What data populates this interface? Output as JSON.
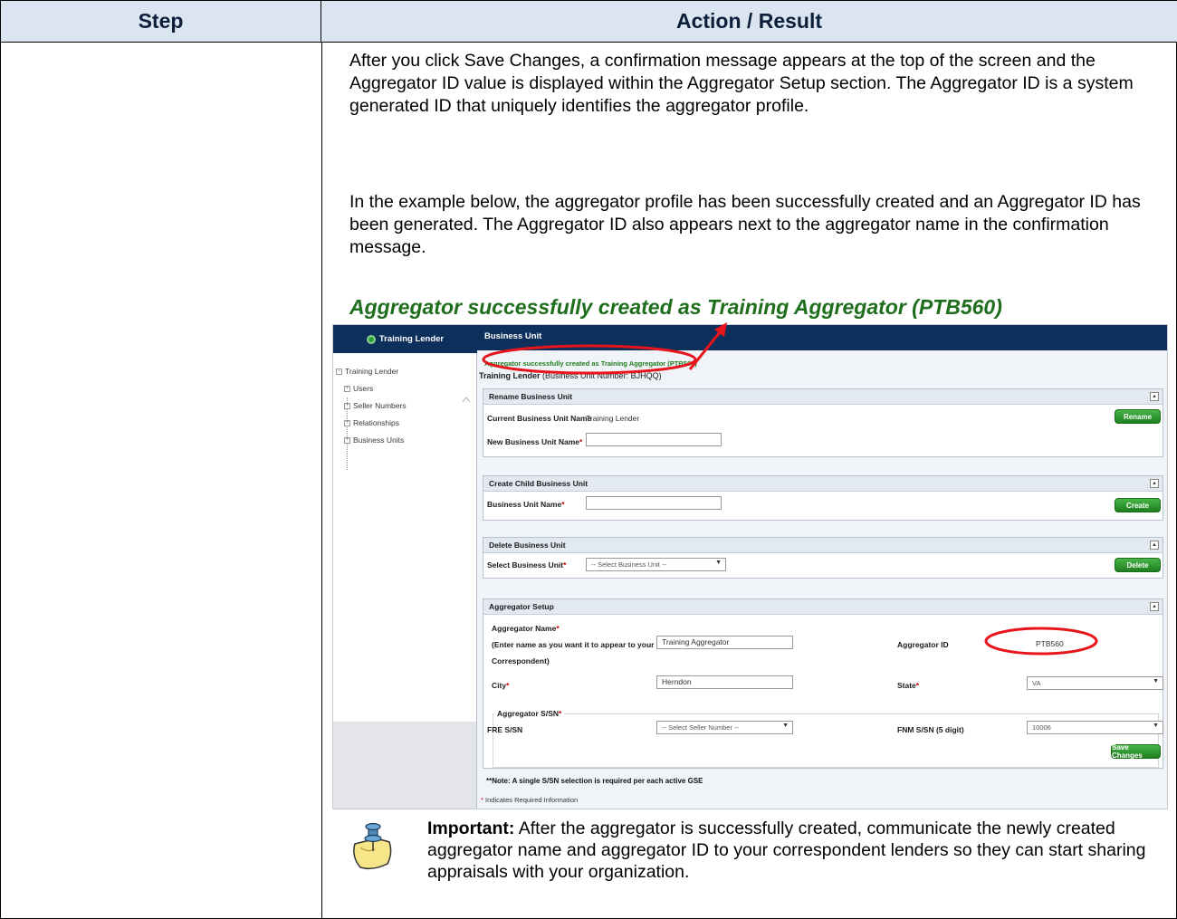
{
  "table": {
    "header_step": "Step",
    "header_action": "Action / Result"
  },
  "content": {
    "paragraph1": "After you click Save Changes, a confirmation message appears at the top of the screen and the Aggregator ID value is displayed within the Aggregator Setup section. The Aggregator ID is a system generated ID that uniquely identifies the aggregator profile.",
    "paragraph2": "In the example below, the aggregator profile has been successfully created and an Aggregator ID has been generated. The Aggregator ID also appears next to the aggregator name in the confirmation message.",
    "caption": "Aggregator successfully created as Training Aggregator (PTB560)",
    "important_label": "Important:",
    "important_text": " After the aggregator is successfully created, communicate the newly created aggregator name and aggregator ID to your correspondent lenders so they can start sharing appraisals with your organization."
  },
  "screenshot": {
    "left_header": "Training Lender",
    "tree": {
      "root": "Training Lender",
      "items": [
        "Users",
        "Seller Numbers",
        "Relationships",
        "Business Units"
      ]
    },
    "main_header": "Business Unit",
    "confirmation": "Aggregator successfully created as Training Aggregator (PTB560)",
    "bu_name": "Training Lender",
    "bu_number": "(Business Unit Number: BJHQQ)",
    "rename": {
      "title": "Rename Business Unit",
      "current_label": "Current Business Unit Name",
      "current_value": "Training Lender",
      "new_label": "New Business Unit Name",
      "button": "Rename"
    },
    "create": {
      "title": "Create Child Business Unit",
      "label": "Business Unit Name",
      "button": "Create"
    },
    "delete": {
      "title": "Delete Business Unit",
      "label": "Select Business Unit",
      "select_value": "-- Select Business Unit --",
      "button": "Delete"
    },
    "aggregator": {
      "title": "Aggregator Setup",
      "name_label": "Aggregator Name",
      "name_hint1": "(Enter name as you want it to appear to your",
      "name_hint2": "Correspondent)",
      "name_value": "Training Aggregator",
      "id_label": "Aggregator ID",
      "id_value": "PTB560",
      "city_label": "City",
      "city_value": "Herndon",
      "state_label": "State",
      "state_value": "VA",
      "ssn_legend": "Aggregator S/SN",
      "fre_label": "FRE S/SN",
      "fre_value": "-- Select Seller Number --",
      "fnm_label": "FNM S/SN (5 digit)",
      "fnm_value": "10006",
      "save_button": "Save Changes"
    },
    "note": "**Note: A single S/SN selection is required per each active GSE",
    "required_note": "Indicates Required Information",
    "required_star": "*"
  },
  "colors": {
    "header_bg": "#dbe5f1",
    "navy": "#0d2f5c",
    "caption_green": "#1e6e1e",
    "annotation_red": "#e8141c",
    "button_green": "#2e9a2e"
  }
}
